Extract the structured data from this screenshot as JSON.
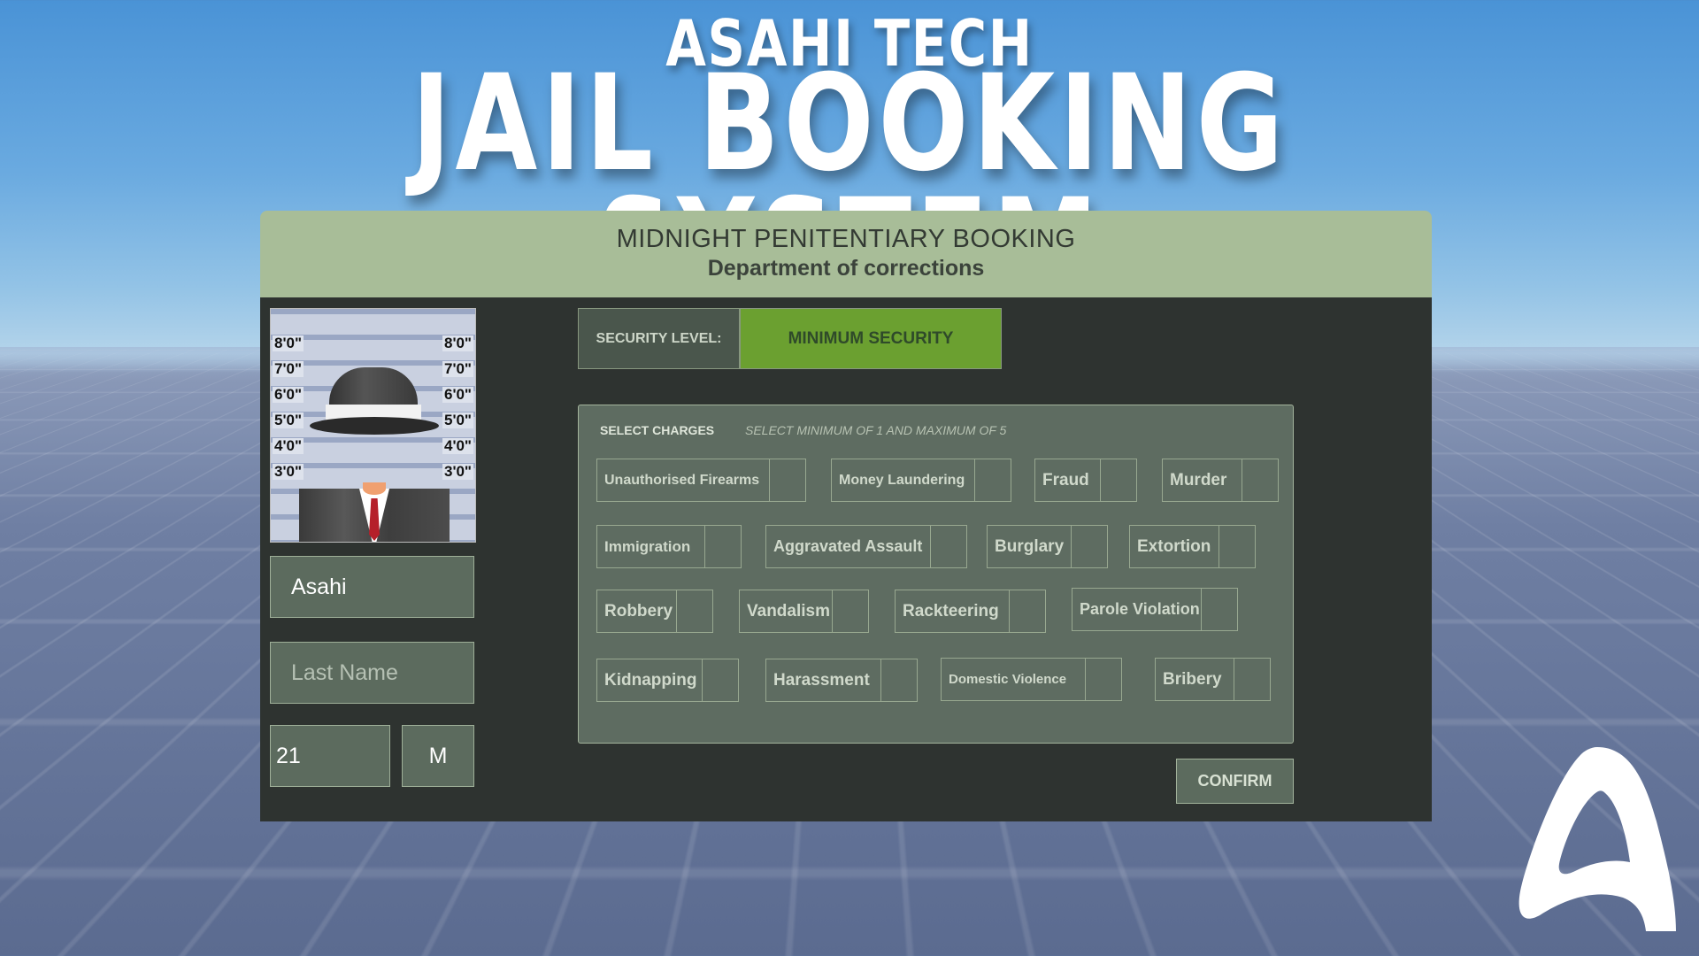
{
  "branding": {
    "top_line": "ASAHI TECH",
    "main_line": "JAIL BOOKING SYSTEM",
    "logo_icon": "asahi-logo-icon"
  },
  "header": {
    "title": "MIDNIGHT PENITENTIARY BOOKING",
    "subtitle": "Department of corrections"
  },
  "mugshot": {
    "height_marks": [
      "8'0\"",
      "7'0\"",
      "6'0\"",
      "5'0\"",
      "4'0\"",
      "3'0\""
    ]
  },
  "form": {
    "first_name_value": "Asahi",
    "last_name_placeholder": "Last Name",
    "age_value": "21",
    "sex_value": "M"
  },
  "security": {
    "label": "SECURITY LEVEL:",
    "value": "MINIMUM SECURITY",
    "value_color": "#6ba030"
  },
  "charges": {
    "title": "SELECT CHARGES",
    "hint": "SELECT MINIMUM OF 1 AND MAXIMUM OF 5",
    "items": [
      "Unauthorised Firearms",
      "Money Laundering",
      "Fraud",
      "Murder",
      "Immigration",
      "Aggravated Assault",
      "Burglary",
      "Extortion",
      "Robbery",
      "Vandalism",
      "Rackteering",
      "Parole Violation",
      "Kidnapping",
      "Harassment",
      "Domestic Violence",
      "Bribery"
    ]
  },
  "actions": {
    "confirm_label": "CONFIRM"
  }
}
